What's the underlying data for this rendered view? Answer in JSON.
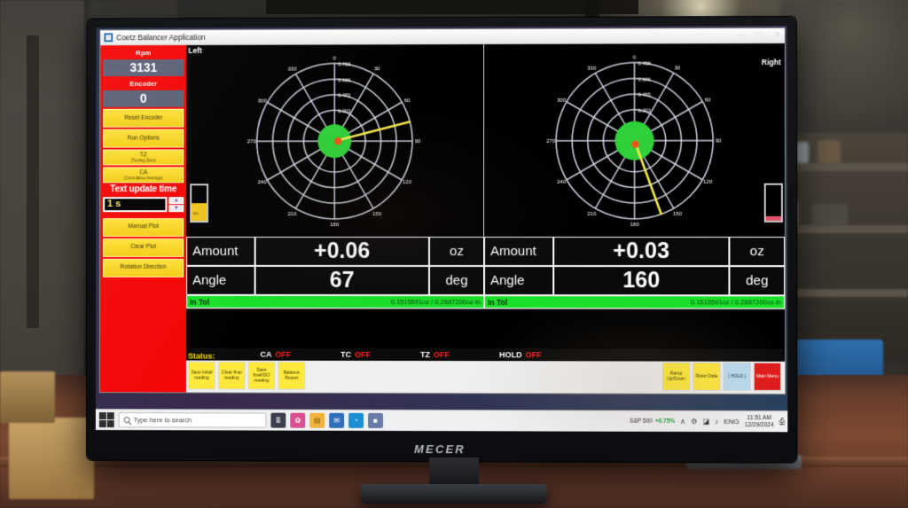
{
  "environment": {
    "monitor_brand": "MECER"
  },
  "window": {
    "title": "Coetz Balancer Application",
    "app_icon": "app-window-icon",
    "controls": {
      "minimize": "—",
      "maximize": "□",
      "close": "✕"
    }
  },
  "sidebar": {
    "rpm_label": "Rpm",
    "rpm_value": "3131",
    "encoder_label": "Encoder",
    "encoder_value": "0",
    "buttons": [
      {
        "label": "Reset Encoder",
        "sub": ""
      },
      {
        "label": "Run Options",
        "sub": ""
      },
      {
        "label": "TZ",
        "sub": "(Tooling Zero)"
      },
      {
        "label": "CA",
        "sub": "(Cumulative Average)"
      }
    ],
    "text_update_time_label": "Text update time",
    "text_update_value": "1 s",
    "spin_up": "▲",
    "spin_down": "▼",
    "buttons_lower": [
      {
        "label": "Manual Plot",
        "sub": ""
      },
      {
        "label": "Clear Plot",
        "sub": ""
      },
      {
        "label": "Rotation Direction",
        "sub": ""
      }
    ]
  },
  "panes": {
    "left_tag": "Left",
    "right_tag": "Right"
  },
  "chart_data": [
    {
      "type": "polar",
      "name": "left-plane-polar-plot",
      "title": "Left",
      "angle_ticks": [
        0,
        30,
        60,
        90,
        120,
        150,
        180,
        210,
        240,
        270,
        300,
        330
      ],
      "angle_tick_labels": [
        "0",
        "30",
        "60",
        "90",
        "120",
        "150",
        "180",
        "210",
        "240",
        "270",
        "300",
        "330"
      ],
      "radial_ticks": [
        0.303,
        0.455,
        0.606,
        0.758
      ],
      "radial_tick_labels": [
        "0.303",
        "0.606",
        "0.455",
        "0.758"
      ],
      "rlim": [
        0,
        0.758
      ],
      "tolerance_circle_radius": 0.22,
      "tolerance_color": "#2fd13a",
      "grid": true,
      "vector": {
        "angle_deg": 67,
        "magnitude": 0.06,
        "r_plot": 0.62,
        "color": "#f2ea4a"
      },
      "marker": {
        "angle_deg": 67,
        "r_plot": 0.055,
        "color": "#f4541c"
      }
    },
    {
      "type": "polar",
      "name": "right-plane-polar-plot",
      "title": "Right",
      "angle_ticks": [
        0,
        30,
        60,
        90,
        120,
        150,
        180,
        210,
        240,
        270,
        300,
        330
      ],
      "angle_tick_labels": [
        "0",
        "30",
        "60",
        "90",
        "120",
        "150",
        "180",
        "210",
        "240",
        "270",
        "300",
        "330"
      ],
      "radial_ticks": [
        0.303,
        0.455,
        0.606,
        0.758
      ],
      "radial_tick_labels": [
        "0.303",
        "0.606",
        "0.455",
        "0.758"
      ],
      "rlim": [
        0,
        0.758
      ],
      "tolerance_circle_radius": 0.22,
      "tolerance_color": "#2fd13a",
      "grid": true,
      "vector": {
        "angle_deg": 160,
        "magnitude": 0.03,
        "r_plot": 0.7,
        "color": "#f2ea4a"
      },
      "marker": {
        "angle_deg": 160,
        "r_plot": 0.05,
        "color": "#f4541c"
      }
    }
  ],
  "readouts": {
    "left": {
      "amount_label": "Amount",
      "amount_value": "+0.06",
      "amount_unit": "oz",
      "angle_label": "Angle",
      "angle_value": "67",
      "angle_unit": "deg",
      "tolerance_status": "In Tol",
      "tolerance_detail": "0.1515591oz /  0.2887200oz-in"
    },
    "right": {
      "amount_label": "Amount",
      "amount_value": "+0.03",
      "amount_unit": "oz",
      "angle_label": "Angle",
      "angle_value": "160",
      "angle_unit": "deg",
      "tolerance_status": "In Tol",
      "tolerance_detail": "0.1515591oz /  0.2887200oz-in"
    }
  },
  "status": {
    "label": "Status:",
    "flags": [
      {
        "key": "CA",
        "value": "OFF"
      },
      {
        "key": "TC",
        "value": "OFF"
      },
      {
        "key": "TZ",
        "value": "OFF"
      },
      {
        "key": "HOLD",
        "value": "OFF"
      }
    ]
  },
  "bottom_buttons_left": [
    {
      "label": "Save initial reading"
    },
    {
      "label": "Clear final reading"
    },
    {
      "label": "Save final/ISO reading"
    },
    {
      "label": "Balance Report"
    }
  ],
  "bottom_buttons_right": [
    {
      "label": "Ramp Up/Down",
      "style": "yellow"
    },
    {
      "label": "Rotor Data",
      "style": "yellow"
    },
    {
      "label": "( HOLD )",
      "style": "blue"
    },
    {
      "label": "Main Menu",
      "style": "red"
    }
  ],
  "taskbar": {
    "start_icon": "windows-start-icon",
    "search_placeholder": "Type here to search",
    "search_icon": "search-icon",
    "pinned": [
      {
        "name": "task-view-icon",
        "glyph": "⌸",
        "color": "#3a3f4b"
      },
      {
        "name": "photos-app-icon",
        "glyph": "✿",
        "color": "#d94f8f"
      },
      {
        "name": "file-explorer-icon",
        "glyph": "▤",
        "color": "#f2b33d"
      },
      {
        "name": "mail-app-icon",
        "glyph": "✉",
        "color": "#2f6fba"
      },
      {
        "name": "edge-browser-icon",
        "glyph": "◔",
        "color": "#1b8fd1"
      },
      {
        "name": "balancer-app-icon",
        "glyph": "■",
        "color": "#6a7aa8"
      }
    ],
    "tray": {
      "stock_name": "S&P 500",
      "stock_change": "+0.75%",
      "chevron": "∧",
      "icons": [
        "⚙",
        "◢",
        "♪",
        "⌨"
      ],
      "time": "11:51 AM",
      "date": "12/29/2024",
      "notification_icon": "notifications-icon"
    }
  },
  "colors": {
    "sidebar_red": "#f40606",
    "button_yellow": "#ffe03a",
    "in_tol_green": "#1ae02a",
    "vector_yellow": "#f2ea4a",
    "marker_orange": "#f4541c",
    "readout_slate": "#5b6176"
  }
}
